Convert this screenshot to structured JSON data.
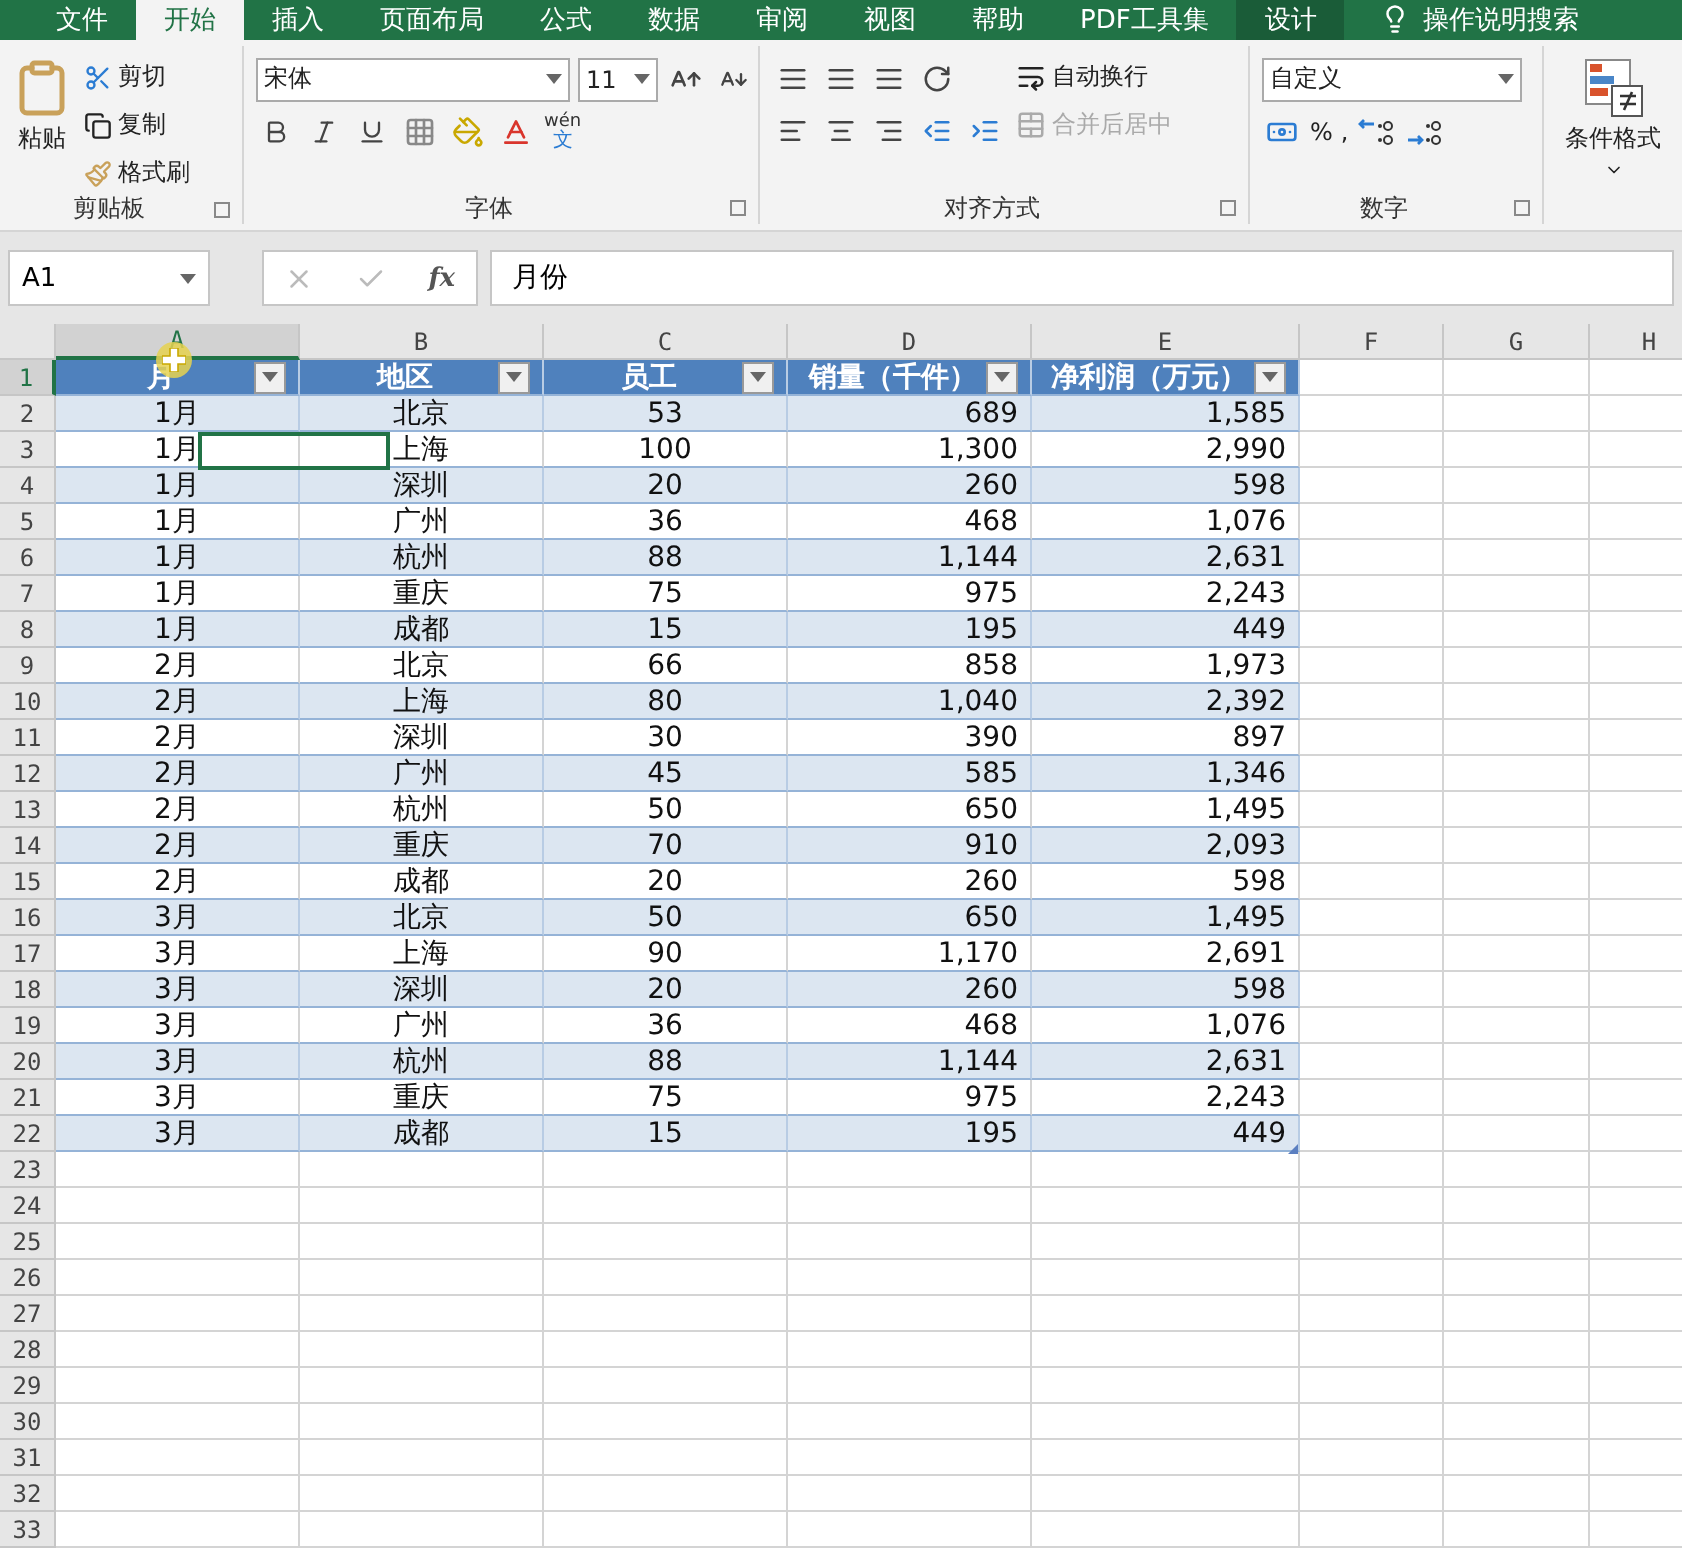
{
  "tabs": [
    {
      "label": "文件",
      "selected": false,
      "kind": "normal"
    },
    {
      "label": "开始",
      "selected": true,
      "kind": "normal"
    },
    {
      "label": "插入",
      "selected": false,
      "kind": "normal"
    },
    {
      "label": "页面布局",
      "selected": false,
      "kind": "normal"
    },
    {
      "label": "公式",
      "selected": false,
      "kind": "normal"
    },
    {
      "label": "数据",
      "selected": false,
      "kind": "normal"
    },
    {
      "label": "审阅",
      "selected": false,
      "kind": "normal"
    },
    {
      "label": "视图",
      "selected": false,
      "kind": "normal"
    },
    {
      "label": "帮助",
      "selected": false,
      "kind": "normal"
    },
    {
      "label": "PDF工具集",
      "selected": false,
      "kind": "normal"
    },
    {
      "label": "设计",
      "selected": false,
      "kind": "contextual"
    },
    {
      "label": "操作说明搜索",
      "selected": false,
      "kind": "search"
    }
  ],
  "ribbon": {
    "clipboard": {
      "title": "剪贴板",
      "paste": "粘贴",
      "cut": "剪切",
      "copy": "复制",
      "format_painter": "格式刷"
    },
    "font": {
      "title": "字体",
      "font_name": "宋体",
      "font_size": "11",
      "phonetic_top": "wén",
      "phonetic_bottom": "文"
    },
    "alignment": {
      "title": "对齐方式",
      "wrap_text": "自动换行",
      "merge_center": "合并后居中",
      "merge_disabled": true
    },
    "number": {
      "title": "数字",
      "format": "自定义",
      "percent": "%",
      "comma": ","
    },
    "styles": {
      "conditional_format": "条件格式"
    }
  },
  "name_box": "A1",
  "fx": "fx",
  "formula": "月份",
  "columns": [
    {
      "label": "A",
      "selected": true
    },
    {
      "label": "B",
      "selected": false
    },
    {
      "label": "C",
      "selected": false
    },
    {
      "label": "D",
      "selected": false
    },
    {
      "label": "E",
      "selected": false
    },
    {
      "label": "F",
      "selected": false
    },
    {
      "label": "G",
      "selected": false
    },
    {
      "label": "H",
      "selected": false
    }
  ],
  "row_headers": [
    {
      "label": "1",
      "selected": true
    },
    {
      "label": "2",
      "selected": false
    },
    {
      "label": "3",
      "selected": false
    },
    {
      "label": "4",
      "selected": false
    },
    {
      "label": "5",
      "selected": false
    },
    {
      "label": "6",
      "selected": false
    },
    {
      "label": "7",
      "selected": false
    },
    {
      "label": "8",
      "selected": false
    },
    {
      "label": "9",
      "selected": false
    },
    {
      "label": "10",
      "selected": false
    },
    {
      "label": "11",
      "selected": false
    },
    {
      "label": "12",
      "selected": false
    },
    {
      "label": "13",
      "selected": false
    },
    {
      "label": "14",
      "selected": false
    },
    {
      "label": "15",
      "selected": false
    },
    {
      "label": "16",
      "selected": false
    },
    {
      "label": "17",
      "selected": false
    },
    {
      "label": "18",
      "selected": false
    },
    {
      "label": "19",
      "selected": false
    },
    {
      "label": "20",
      "selected": false
    },
    {
      "label": "21",
      "selected": false
    },
    {
      "label": "22",
      "selected": false
    },
    {
      "label": "23",
      "selected": false
    },
    {
      "label": "24",
      "selected": false
    },
    {
      "label": "25",
      "selected": false
    },
    {
      "label": "26",
      "selected": false
    },
    {
      "label": "27",
      "selected": false
    },
    {
      "label": "28",
      "selected": false
    },
    {
      "label": "29",
      "selected": false
    },
    {
      "label": "30",
      "selected": false
    },
    {
      "label": "31",
      "selected": false
    },
    {
      "label": "32",
      "selected": false
    },
    {
      "label": "33",
      "selected": false
    }
  ],
  "table": {
    "headers": [
      "月",
      "地区",
      "员工",
      "销量（千件）",
      "净利润（万元）"
    ],
    "rows": [
      [
        "1月",
        "北京",
        "53",
        "689",
        "1,585"
      ],
      [
        "1月",
        "上海",
        "100",
        "1,300",
        "2,990"
      ],
      [
        "1月",
        "深圳",
        "20",
        "260",
        "598"
      ],
      [
        "1月",
        "广州",
        "36",
        "468",
        "1,076"
      ],
      [
        "1月",
        "杭州",
        "88",
        "1,144",
        "2,631"
      ],
      [
        "1月",
        "重庆",
        "75",
        "975",
        "2,243"
      ],
      [
        "1月",
        "成都",
        "15",
        "195",
        "449"
      ],
      [
        "2月",
        "北京",
        "66",
        "858",
        "1,973"
      ],
      [
        "2月",
        "上海",
        "80",
        "1,040",
        "2,392"
      ],
      [
        "2月",
        "深圳",
        "30",
        "390",
        "897"
      ],
      [
        "2月",
        "广州",
        "45",
        "585",
        "1,346"
      ],
      [
        "2月",
        "杭州",
        "50",
        "650",
        "1,495"
      ],
      [
        "2月",
        "重庆",
        "70",
        "910",
        "2,093"
      ],
      [
        "2月",
        "成都",
        "20",
        "260",
        "598"
      ],
      [
        "3月",
        "北京",
        "50",
        "650",
        "1,495"
      ],
      [
        "3月",
        "上海",
        "90",
        "1,170",
        "2,691"
      ],
      [
        "3月",
        "深圳",
        "20",
        "260",
        "598"
      ],
      [
        "3月",
        "广州",
        "36",
        "468",
        "1,076"
      ],
      [
        "3月",
        "杭州",
        "88",
        "1,144",
        "2,631"
      ],
      [
        "3月",
        "重庆",
        "75",
        "975",
        "2,243"
      ],
      [
        "3月",
        "成都",
        "15",
        "195",
        "449"
      ]
    ]
  }
}
